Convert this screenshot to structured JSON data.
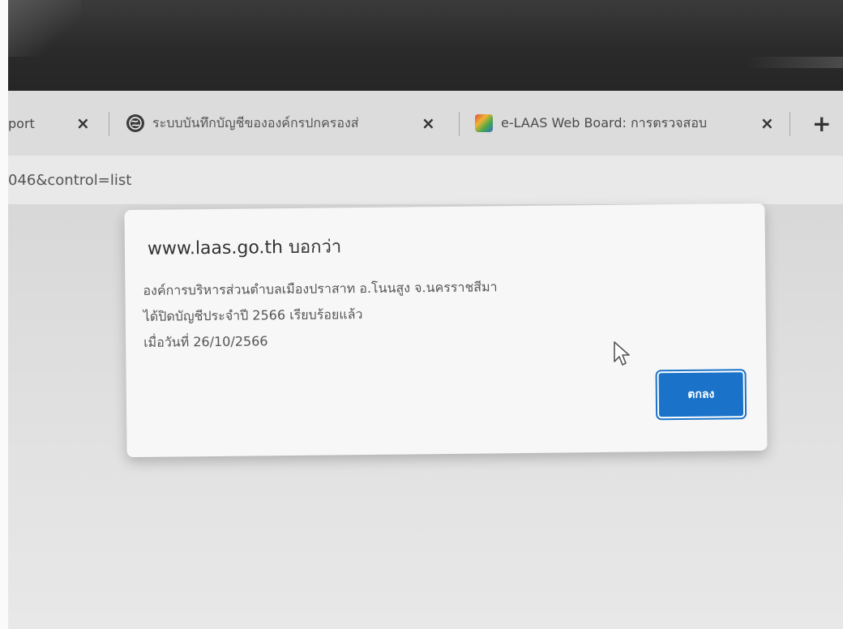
{
  "tabs": [
    {
      "label": "port",
      "icon": ""
    },
    {
      "label": "ระบบบันทึกบัญชีขององค์กรปกครองส่",
      "icon": "globe-icon"
    },
    {
      "label": "e-LAAS Web Board: การตรวจสอบ",
      "icon": "board-icon"
    }
  ],
  "tab_close_symbol": "×",
  "new_tab_symbol": "+",
  "address_bar": {
    "url_fragment": "046&control=list"
  },
  "dialog": {
    "title": "www.laas.go.th บอกว่า",
    "message_lines": [
      "องค์การบริหารส่วนตำบลเมืองปราสาท อ.โนนสูง จ.นครราชสีมา",
      "ได้ปิดบัญชีประจำปี 2566 เรียบร้อยแล้ว",
      "เมื่อวันที่ 26/10/2566"
    ],
    "ok_label": "ตกลง"
  },
  "colors": {
    "accent": "#1a73c9",
    "dialog_bg": "#f7f7f7",
    "tabstrip_bg": "#dcdcdc"
  }
}
